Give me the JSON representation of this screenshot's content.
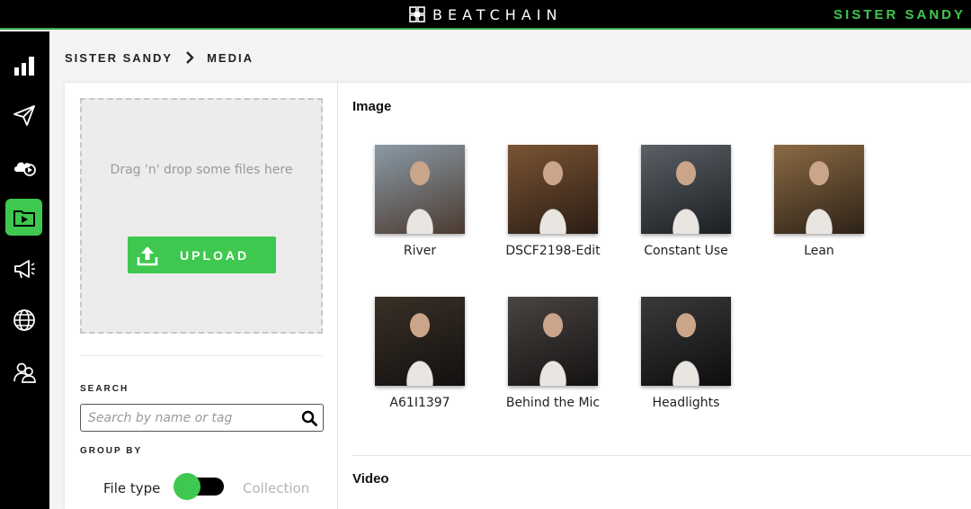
{
  "app": {
    "brand": "BEATCHAIN",
    "account_name": "SISTER SANDY",
    "colors": {
      "accent": "#3ec84f",
      "topbar": "#000000",
      "sidebar": "#000000"
    }
  },
  "sidebar": {
    "items": [
      {
        "icon": "bar-chart-icon",
        "active": false
      },
      {
        "icon": "paper-plane-icon",
        "active": false
      },
      {
        "icon": "cloud-play-icon",
        "active": false
      },
      {
        "icon": "media-folder-icon",
        "active": true
      },
      {
        "icon": "megaphone-icon",
        "active": false
      },
      {
        "icon": "globe-icon",
        "active": false
      },
      {
        "icon": "users-icon",
        "active": false
      }
    ]
  },
  "breadcrumb": {
    "artist": "SISTER SANDY",
    "page": "MEDIA"
  },
  "upload": {
    "dropzone_text": "Drag 'n' drop some files here",
    "button_label": "UPLOAD"
  },
  "search": {
    "label": "SEARCH",
    "placeholder": "Search by name or tag",
    "value": ""
  },
  "group_by": {
    "label": "GROUP BY",
    "option_left": "File type",
    "option_right": "Collection",
    "selected": "File type"
  },
  "sections": {
    "image_title": "Image",
    "video_title": "Video"
  },
  "images": [
    {
      "name": "River",
      "colors": [
        "#8a9aa6",
        "#4b3a30"
      ]
    },
    {
      "name": "DSCF2198-Edit",
      "colors": [
        "#7a5434",
        "#2b1d14"
      ]
    },
    {
      "name": "Constant Use",
      "colors": [
        "#5b6066",
        "#1b1e22"
      ]
    },
    {
      "name": "Lean",
      "colors": [
        "#8b6a44",
        "#2d2217"
      ]
    },
    {
      "name": "A61I1397",
      "colors": [
        "#3a3026",
        "#121010"
      ]
    },
    {
      "name": "Behind the Mic",
      "colors": [
        "#4a4442",
        "#141212"
      ]
    },
    {
      "name": "Headlights",
      "colors": [
        "#3a3a3c",
        "#0d0d0e"
      ]
    }
  ]
}
